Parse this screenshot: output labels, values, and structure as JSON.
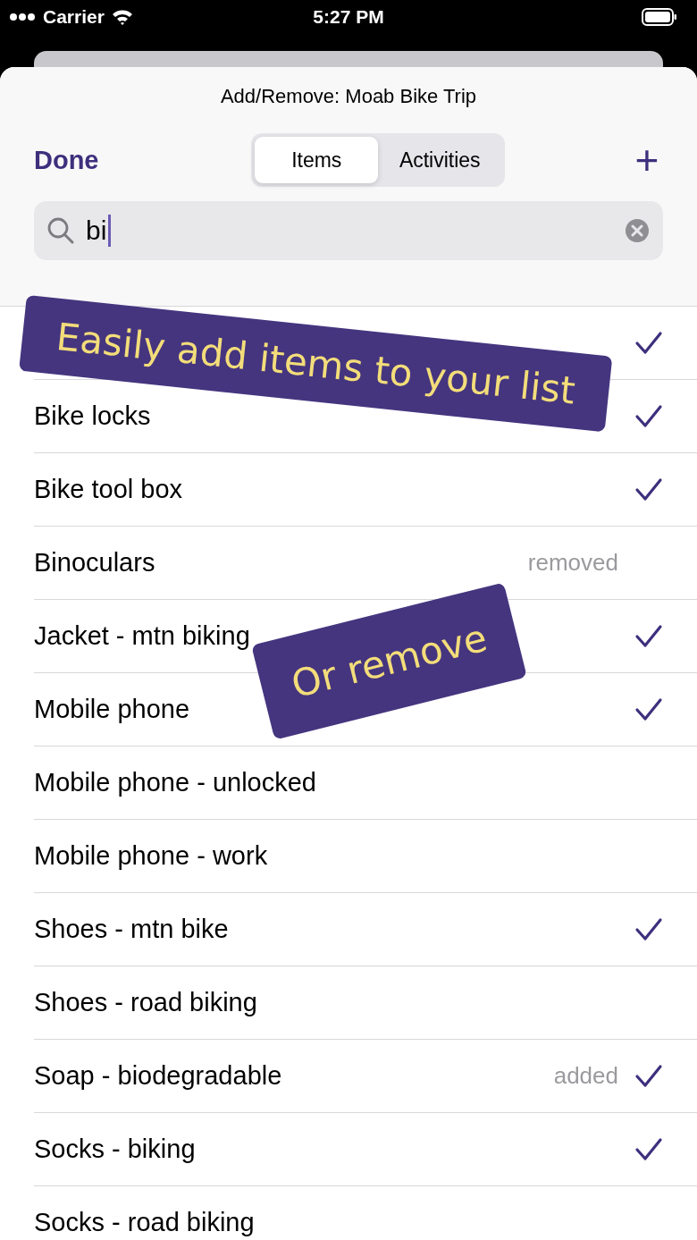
{
  "status_bar": {
    "carrier": "Carrier",
    "time": "5:27 PM"
  },
  "sheet": {
    "title": "Add/Remove: Moab Bike Trip",
    "done": "Done",
    "add": "+"
  },
  "tabs": [
    {
      "label": "Items",
      "selected": true
    },
    {
      "label": "Activities",
      "selected": false
    }
  ],
  "search": {
    "value": "bi"
  },
  "rows": [
    {
      "checked": true
    },
    {
      "label": "Bike locks",
      "checked": true
    },
    {
      "label": "Bike tool box",
      "checked": true
    },
    {
      "label": "Binoculars",
      "checked": false,
      "status": "removed"
    },
    {
      "label": "Jacket - mtn biking",
      "checked": true
    },
    {
      "label": "Mobile phone",
      "checked": true
    },
    {
      "label": "Mobile phone - unlocked",
      "checked": false
    },
    {
      "label": "Mobile phone - work",
      "checked": false
    },
    {
      "label": "Shoes - mtn bike",
      "checked": true
    },
    {
      "label": "Shoes - road biking",
      "checked": false
    },
    {
      "label": "Soap - biodegradable",
      "checked": true,
      "status": "added"
    },
    {
      "label": "Socks - biking",
      "checked": true
    },
    {
      "label": "Socks - road biking",
      "checked": false
    }
  ],
  "banners": [
    {
      "text": "Easily add items to your list",
      "kind": "large"
    },
    {
      "text": "Or remove",
      "kind": "small"
    }
  ]
}
